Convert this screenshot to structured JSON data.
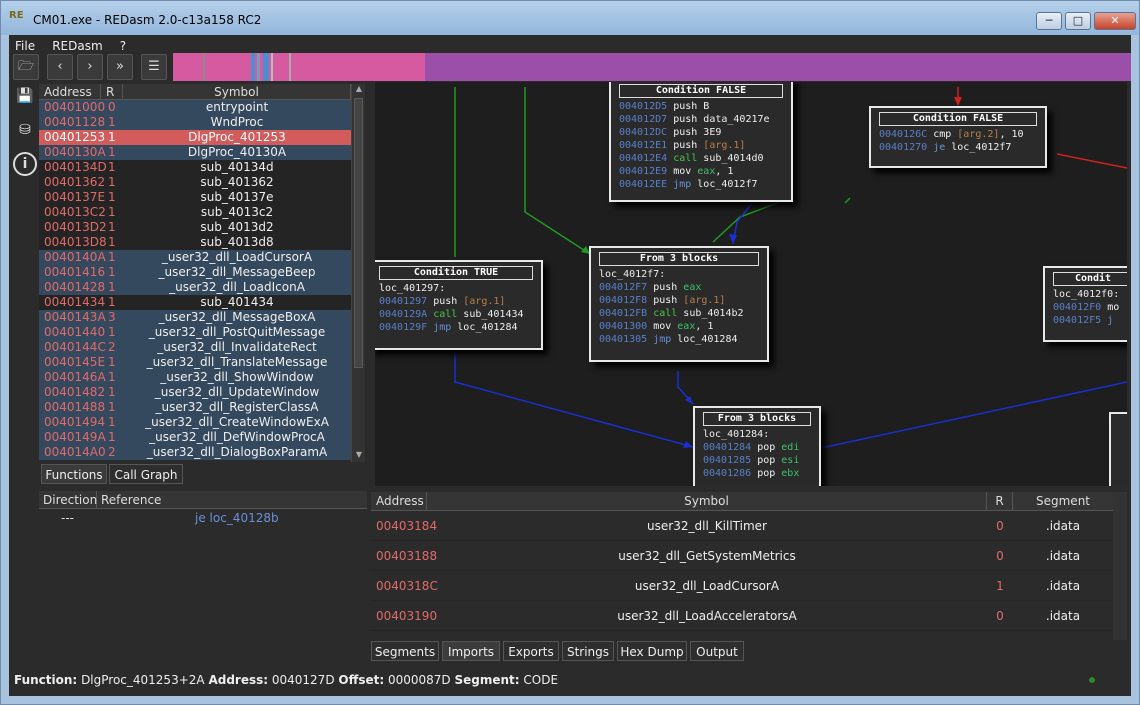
{
  "window": {
    "title": "CM01.exe - REDasm 2.0-c13a158 RC2",
    "logo": "RE"
  },
  "menu": [
    "File",
    "REDasm",
    "?"
  ],
  "toolbar": {
    "buttons": [
      "open",
      "back",
      "forward",
      "goto",
      "listing"
    ]
  },
  "functions": {
    "columns": [
      "Address",
      "R",
      "Symbol"
    ],
    "rows": [
      {
        "address": "00401000",
        "r": "0",
        "symbol": "entrypoint",
        "style": "blue"
      },
      {
        "address": "00401128",
        "r": "1",
        "symbol": "WndProc",
        "style": "blue"
      },
      {
        "address": "00401253",
        "r": "1",
        "symbol": "DlgProc_401253",
        "style": "red"
      },
      {
        "address": "0040130A",
        "r": "1",
        "symbol": "DlgProc_40130A",
        "style": "blue"
      },
      {
        "address": "0040134D",
        "r": "1",
        "symbol": "sub_40134d",
        "style": "dark"
      },
      {
        "address": "00401362",
        "r": "1",
        "symbol": "sub_401362",
        "style": "dark"
      },
      {
        "address": "0040137E",
        "r": "1",
        "symbol": "sub_40137e",
        "style": "dark"
      },
      {
        "address": "004013C2",
        "r": "1",
        "symbol": "sub_4013c2",
        "style": "dark"
      },
      {
        "address": "004013D2",
        "r": "1",
        "symbol": "sub_4013d2",
        "style": "dark"
      },
      {
        "address": "004013D8",
        "r": "1",
        "symbol": "sub_4013d8",
        "style": "dark"
      },
      {
        "address": "0040140A",
        "r": "1",
        "symbol": "_user32_dll_LoadCursorA",
        "style": "blue"
      },
      {
        "address": "00401416",
        "r": "1",
        "symbol": "_user32_dll_MessageBeep",
        "style": "blue"
      },
      {
        "address": "00401428",
        "r": "1",
        "symbol": "_user32_dll_LoadIconA",
        "style": "blue"
      },
      {
        "address": "00401434",
        "r": "1",
        "symbol": "sub_401434",
        "style": "dark"
      },
      {
        "address": "0040143A",
        "r": "3",
        "symbol": "_user32_dll_MessageBoxA",
        "style": "blue"
      },
      {
        "address": "00401440",
        "r": "1",
        "symbol": "_user32_dll_PostQuitMessage",
        "style": "blue"
      },
      {
        "address": "0040144C",
        "r": "2",
        "symbol": "_user32_dll_InvalidateRect",
        "style": "blue"
      },
      {
        "address": "0040145E",
        "r": "1",
        "symbol": "_user32_dll_TranslateMessage",
        "style": "blue"
      },
      {
        "address": "0040146A",
        "r": "1",
        "symbol": "_user32_dll_ShowWindow",
        "style": "blue"
      },
      {
        "address": "00401482",
        "r": "1",
        "symbol": "_user32_dll_UpdateWindow",
        "style": "blue"
      },
      {
        "address": "00401488",
        "r": "1",
        "symbol": "_user32_dll_RegisterClassA",
        "style": "blue"
      },
      {
        "address": "00401494",
        "r": "1",
        "symbol": "_user32_dll_CreateWindowExA",
        "style": "blue"
      },
      {
        "address": "0040149A",
        "r": "1",
        "symbol": "_user32_dll_DefWindowProcA",
        "style": "blue"
      },
      {
        "address": "004014A0",
        "r": "2",
        "symbol": "_user32_dll_DialogBoxParamA",
        "style": "blue"
      }
    ],
    "tabs": [
      "Functions",
      "Call Graph"
    ],
    "active_tab": "Functions"
  },
  "references": {
    "columns": [
      "Direction",
      "Reference"
    ],
    "rows": [
      {
        "direction": "---",
        "reference": "je loc_40128b"
      }
    ]
  },
  "graph": {
    "blocks": [
      {
        "id": "b1",
        "title": "Condition FALSE",
        "lines": [
          [
            [
              "ad",
              "004012D5 "
            ],
            [
              "mn",
              "push "
            ],
            [
              "op",
              "B"
            ]
          ],
          [
            [
              "ad",
              "004012D7 "
            ],
            [
              "mn",
              "push "
            ],
            [
              "op",
              "data_40217e"
            ]
          ],
          [
            [
              "ad",
              "004012DC "
            ],
            [
              "mn",
              "push "
            ],
            [
              "op",
              "3E9"
            ]
          ],
          [
            [
              "ad",
              "004012E1 "
            ],
            [
              "mn",
              "push "
            ],
            [
              "arg",
              "[arg.1]"
            ]
          ],
          [
            [
              "ad",
              "004012E4 "
            ],
            [
              "mnc",
              "call "
            ],
            [
              "op",
              "sub_4014d0"
            ]
          ],
          [
            [
              "ad",
              "004012E9 "
            ],
            [
              "mn",
              "mov "
            ],
            [
              "reg",
              "eax"
            ],
            [
              "op",
              ", 1"
            ]
          ],
          [
            [
              "ad",
              "004012EE "
            ],
            [
              "mnj",
              "jmp "
            ],
            [
              "op",
              "loc_4012f7"
            ]
          ]
        ]
      },
      {
        "id": "b2",
        "title": "Condition FALSE",
        "lines": [
          [
            [
              "ad",
              "0040126C "
            ],
            [
              "mn",
              "cmp "
            ],
            [
              "arg",
              "[arg.2]"
            ],
            [
              "op",
              ", 10"
            ]
          ],
          [
            [
              "ad",
              "00401270 "
            ],
            [
              "mnj",
              "je "
            ],
            [
              "op",
              "loc_4012f7"
            ]
          ]
        ]
      },
      {
        "id": "b3",
        "title": "Condition TRUE",
        "lines": [
          [
            [
              "op",
              "loc_401297:"
            ]
          ],
          [
            [
              "ad",
              "00401297 "
            ],
            [
              "mn",
              "push "
            ],
            [
              "arg",
              "[arg.1]"
            ]
          ],
          [
            [
              "ad",
              "0040129A "
            ],
            [
              "mnc",
              "call "
            ],
            [
              "op",
              "sub_401434"
            ]
          ],
          [
            [
              "ad",
              "0040129F "
            ],
            [
              "mnj",
              "jmp "
            ],
            [
              "op",
              "loc_401284"
            ]
          ]
        ]
      },
      {
        "id": "b4",
        "title": "From 3 blocks",
        "lines": [
          [
            [
              "op",
              "loc_4012f7:"
            ]
          ],
          [
            [
              "ad",
              "004012F7 "
            ],
            [
              "mn",
              "push "
            ],
            [
              "reg",
              "eax"
            ]
          ],
          [
            [
              "ad",
              "004012F8 "
            ],
            [
              "mn",
              "push "
            ],
            [
              "arg",
              "[arg.1]"
            ]
          ],
          [
            [
              "ad",
              "004012FB "
            ],
            [
              "mnc",
              "call "
            ],
            [
              "op",
              "sub_4014b2"
            ]
          ],
          [
            [
              "ad",
              "00401300 "
            ],
            [
              "mn",
              "mov "
            ],
            [
              "reg",
              "eax"
            ],
            [
              "op",
              ", 1"
            ]
          ],
          [
            [
              "ad",
              "00401305 "
            ],
            [
              "mnj",
              "jmp "
            ],
            [
              "op",
              "loc_401284"
            ]
          ]
        ]
      },
      {
        "id": "b5",
        "title": "Condit",
        "lines": [
          [
            [
              "op",
              "loc_4012f0:"
            ]
          ],
          [
            [
              "ad",
              "004012F0 "
            ],
            [
              "mn",
              "mo"
            ]
          ],
          [
            [
              "ad",
              "004012F5 "
            ],
            [
              "mnj",
              "j"
            ]
          ]
        ]
      },
      {
        "id": "b6",
        "title": "From 3 blocks",
        "lines": [
          [
            [
              "op",
              "loc_401284:"
            ]
          ],
          [
            [
              "ad",
              "00401284 "
            ],
            [
              "mn",
              "pop "
            ],
            [
              "reg",
              "edi"
            ]
          ],
          [
            [
              "ad",
              "00401285 "
            ],
            [
              "mn",
              "pop "
            ],
            [
              "reg",
              "esi"
            ]
          ],
          [
            [
              "ad",
              "00401286 "
            ],
            [
              "mn",
              "pop "
            ],
            [
              "reg",
              "ebx"
            ]
          ]
        ]
      }
    ]
  },
  "imports": {
    "columns": [
      "Address",
      "Symbol",
      "R",
      "Segment"
    ],
    "rows": [
      {
        "address": "00403184",
        "symbol": "user32_dll_KillTimer",
        "r": "0",
        "segment": ".idata"
      },
      {
        "address": "00403188",
        "symbol": "user32_dll_GetSystemMetrics",
        "r": "0",
        "segment": ".idata"
      },
      {
        "address": "0040318C",
        "symbol": "user32_dll_LoadCursorA",
        "r": "1",
        "segment": ".idata"
      },
      {
        "address": "00403190",
        "symbol": "user32_dll_LoadAcceleratorsA",
        "r": "0",
        "segment": ".idata"
      }
    ]
  },
  "bottom_tabs": [
    "Segments",
    "Imports",
    "Exports",
    "Strings",
    "Hex Dump",
    "Output"
  ],
  "active_bottom_tab": "Imports",
  "status": {
    "function_label": "Function:",
    "function": "DlgProc_401253+2A",
    "address_label": "Address:",
    "address": "0040127D",
    "offset_label": "Offset:",
    "offset": "0000087D",
    "segment_label": "Segment:",
    "segment": "CODE"
  },
  "colors": {
    "accent_red": "#d25b5b",
    "row_blue": "#34495e",
    "navbar_purple": "#9b4fa8",
    "navbar_pink": "#d65aa0"
  }
}
